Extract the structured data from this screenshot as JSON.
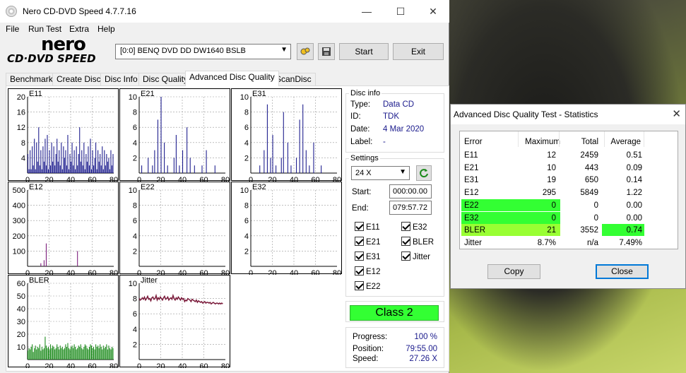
{
  "window": {
    "title": "Nero CD-DVD Speed 4.7.7.16",
    "minimize": "—",
    "maximize": "☐",
    "close": "✕"
  },
  "menu": [
    "File",
    "Run Test",
    "Extra",
    "Help"
  ],
  "logo": {
    "line1": "nero",
    "line2": "CD·DVD SPEED"
  },
  "toolbar": {
    "drive": "[0:0]   BENQ DVD DD DW1640 BSLB",
    "start": "Start",
    "exit": "Exit"
  },
  "tabs": [
    "Benchmark",
    "Create Disc",
    "Disc Info",
    "Disc Quality",
    "Advanced Disc Quality",
    "ScanDisc"
  ],
  "active_tab": "Advanced Disc Quality",
  "disc_info": {
    "group": "Disc info",
    "type_label": "Type:",
    "type": "Data CD",
    "id_label": "ID:",
    "id": "TDK",
    "date_label": "Date:",
    "date": "4 Mar 2020",
    "label_label": "Label:",
    "label": "-"
  },
  "settings": {
    "group": "Settings",
    "speed": "24 X",
    "start_label": "Start:",
    "start": "000:00.00",
    "end_label": "End:",
    "end": "079:57.72",
    "checks": {
      "e11": "E11",
      "e32": "E32",
      "e21": "E21",
      "bler": "BLER",
      "e31": "E31",
      "jitter": "Jitter",
      "e12": "E12",
      "e22": "E22"
    }
  },
  "class_label": "Class 2",
  "progress": {
    "progress_label": "Progress:",
    "progress": "100 %",
    "position_label": "Position:",
    "position": "79:55.00",
    "speed_label": "Speed:",
    "speed": "27.26 X"
  },
  "chart_data": [
    {
      "type": "bar",
      "title": "E11",
      "x": [
        0,
        20,
        40,
        60,
        80
      ],
      "ylim": [
        0,
        20
      ],
      "yticks": [
        4,
        8,
        12,
        16,
        20
      ],
      "color": "#1a1a8c",
      "values": [
        5,
        1,
        6,
        1,
        7,
        2,
        9,
        1,
        8,
        3,
        12,
        2,
        6,
        1,
        7,
        3,
        9,
        2,
        10,
        1,
        6,
        2,
        8,
        3,
        7,
        2,
        5,
        9,
        3,
        6,
        2,
        8,
        1,
        7,
        4,
        6,
        2,
        10,
        1,
        5,
        3,
        8,
        2,
        6,
        1,
        7,
        2,
        5,
        12,
        3,
        6,
        2,
        8,
        1,
        5,
        3,
        7,
        2,
        9,
        1,
        6,
        2,
        4,
        8,
        1,
        6,
        3,
        5,
        2,
        7,
        1,
        6,
        2,
        5,
        3,
        4,
        1,
        6,
        2,
        5
      ]
    },
    {
      "type": "bar",
      "title": "E21",
      "x": [
        0,
        20,
        40,
        60,
        80
      ],
      "ylim": [
        0,
        10
      ],
      "yticks": [
        2,
        4,
        6,
        8,
        10
      ],
      "color": "#1a1a8c",
      "values": [
        0,
        0,
        1,
        0,
        0,
        0,
        0,
        0,
        2,
        0,
        0,
        0,
        1,
        0,
        3,
        0,
        0,
        7,
        0,
        0,
        10,
        0,
        0,
        4,
        0,
        0,
        1,
        0,
        0,
        0,
        0,
        0,
        2,
        0,
        5,
        0,
        0,
        1,
        0,
        0,
        3,
        0,
        0,
        0,
        6,
        0,
        0,
        2,
        0,
        0,
        0,
        1,
        0,
        0,
        0,
        0,
        0,
        0,
        1,
        0,
        0,
        0,
        3,
        0,
        0,
        0,
        0,
        0,
        0,
        0,
        1,
        0,
        0,
        0,
        0,
        0,
        0,
        0,
        0,
        0
      ]
    },
    {
      "type": "bar",
      "title": "E31",
      "x": [
        0,
        20,
        40,
        60,
        80
      ],
      "ylim": [
        0,
        10
      ],
      "yticks": [
        2,
        4,
        6,
        8,
        10
      ],
      "color": "#1a1a8c",
      "values": [
        0,
        0,
        0,
        0,
        0,
        0,
        0,
        0,
        1,
        0,
        0,
        0,
        3,
        0,
        0,
        9,
        0,
        0,
        2,
        0,
        5,
        0,
        0,
        1,
        0,
        0,
        0,
        0,
        2,
        0,
        8,
        0,
        0,
        0,
        4,
        0,
        0,
        1,
        0,
        0,
        0,
        0,
        2,
        0,
        0,
        7,
        0,
        0,
        9,
        0,
        0,
        3,
        0,
        0,
        1,
        0,
        0,
        0,
        4,
        0,
        0,
        0,
        0,
        0,
        0,
        1,
        0,
        0,
        0,
        0,
        0,
        0,
        0,
        0,
        0,
        0,
        0,
        0,
        0,
        0
      ]
    },
    {
      "type": "bar",
      "title": "E12",
      "x": [
        0,
        20,
        40,
        60,
        80
      ],
      "ylim": [
        0,
        500
      ],
      "yticks": [
        100,
        200,
        300,
        400,
        500
      ],
      "color": "#7a1a7a",
      "values": [
        0,
        0,
        0,
        0,
        0,
        0,
        0,
        0,
        0,
        0,
        0,
        0,
        20,
        0,
        0,
        40,
        0,
        150,
        0,
        0,
        0,
        0,
        0,
        0,
        0,
        0,
        0,
        0,
        0,
        0,
        0,
        0,
        0,
        0,
        0,
        0,
        0,
        0,
        0,
        0,
        0,
        0,
        0,
        0,
        0,
        0,
        100,
        0,
        0,
        0,
        0,
        0,
        0,
        0,
        0,
        0,
        0,
        0,
        0,
        0,
        0,
        0,
        0,
        0,
        0,
        0,
        0,
        0,
        0,
        0,
        0,
        0,
        0,
        0,
        0,
        0,
        0,
        0,
        0,
        0
      ]
    },
    {
      "type": "bar",
      "title": "E22",
      "x": [
        0,
        20,
        40,
        60,
        80
      ],
      "ylim": [
        0,
        10
      ],
      "yticks": [
        2,
        4,
        6,
        8,
        10
      ],
      "color": "#1a1a8c",
      "values": []
    },
    {
      "type": "bar",
      "title": "E32",
      "x": [
        0,
        20,
        40,
        60,
        80
      ],
      "ylim": [
        0,
        10
      ],
      "yticks": [
        2,
        4,
        6,
        8,
        10
      ],
      "color": "#1a1a8c",
      "values": []
    },
    {
      "type": "bar",
      "title": "BLER",
      "x": [
        0,
        20,
        40,
        60,
        80
      ],
      "ylim": [
        0,
        60
      ],
      "yticks": [
        10,
        20,
        30,
        40,
        50,
        60
      ],
      "color": "#1a8a1a",
      "values": [
        7,
        9,
        8,
        10,
        12,
        6,
        9,
        11,
        8,
        10,
        9,
        12,
        7,
        10,
        8,
        9,
        18,
        11,
        9,
        10,
        8,
        12,
        9,
        11,
        10,
        8,
        9,
        12,
        10,
        8,
        11,
        9,
        10,
        8,
        9,
        12,
        10,
        13,
        9,
        8,
        10,
        11,
        9,
        12,
        10,
        8,
        9,
        11,
        10,
        12,
        9,
        8,
        10,
        12,
        11,
        9,
        8,
        10,
        12,
        11,
        9,
        10,
        8,
        12,
        10,
        11,
        9,
        12,
        10,
        8,
        11,
        9,
        10,
        12,
        8,
        11,
        9,
        8,
        10,
        9
      ]
    },
    {
      "type": "line",
      "title": "Jitter",
      "x": [
        0,
        20,
        40,
        60,
        80
      ],
      "ylim": [
        0,
        10
      ],
      "yticks": [
        2,
        4,
        6,
        8,
        10
      ],
      "color": "#7a1a3a",
      "values": [
        8.0,
        7.8,
        7.9,
        8.1,
        7.9,
        8.2,
        7.8,
        8.0,
        8.3,
        7.9,
        8.0,
        7.7,
        8.1,
        8.2,
        7.9,
        8.0,
        8.4,
        7.8,
        8.1,
        7.9,
        8.2,
        8.0,
        7.8,
        8.1,
        8.3,
        7.9,
        8.0,
        8.2,
        7.8,
        8.0,
        8.1,
        7.9,
        8.4,
        8.0,
        7.8,
        8.1,
        7.9,
        8.2,
        8.0,
        7.8,
        8.1,
        7.9,
        8.0,
        7.6,
        7.8,
        7.7,
        8.0,
        7.9,
        7.8,
        7.6,
        7.9,
        7.8,
        7.7,
        7.6,
        7.8,
        7.5,
        7.7,
        7.6,
        7.5,
        7.6,
        7.4,
        7.5,
        7.6,
        7.4,
        7.5,
        7.5,
        7.4,
        7.5,
        7.3,
        7.4,
        7.5,
        7.4,
        7.3,
        7.4,
        7.4,
        7.3,
        7.4,
        7.3,
        7.4,
        7.3
      ]
    }
  ],
  "stats_dialog": {
    "title": "Advanced Disc Quality Test - Statistics",
    "headers": [
      "Error",
      "Maximum",
      "Total",
      "Average"
    ],
    "rows": [
      [
        "E11",
        "12",
        "2459",
        "0.51"
      ],
      [
        "E21",
        "10",
        "443",
        "0.09"
      ],
      [
        "E31",
        "19",
        "650",
        "0.14"
      ],
      [
        "E12",
        "295",
        "5849",
        "1.22"
      ],
      [
        "E22",
        "0",
        "0",
        "0.00"
      ],
      [
        "E32",
        "0",
        "0",
        "0.00"
      ],
      [
        "BLER",
        "21",
        "3552",
        "0.74"
      ],
      [
        "Jitter",
        "8.7%",
        "n/a",
        "7.49%"
      ]
    ],
    "copy": "Copy",
    "close": "Close",
    "highlight_colors": {
      "pass": "#33ff33",
      "bler": "#99ff33"
    }
  }
}
